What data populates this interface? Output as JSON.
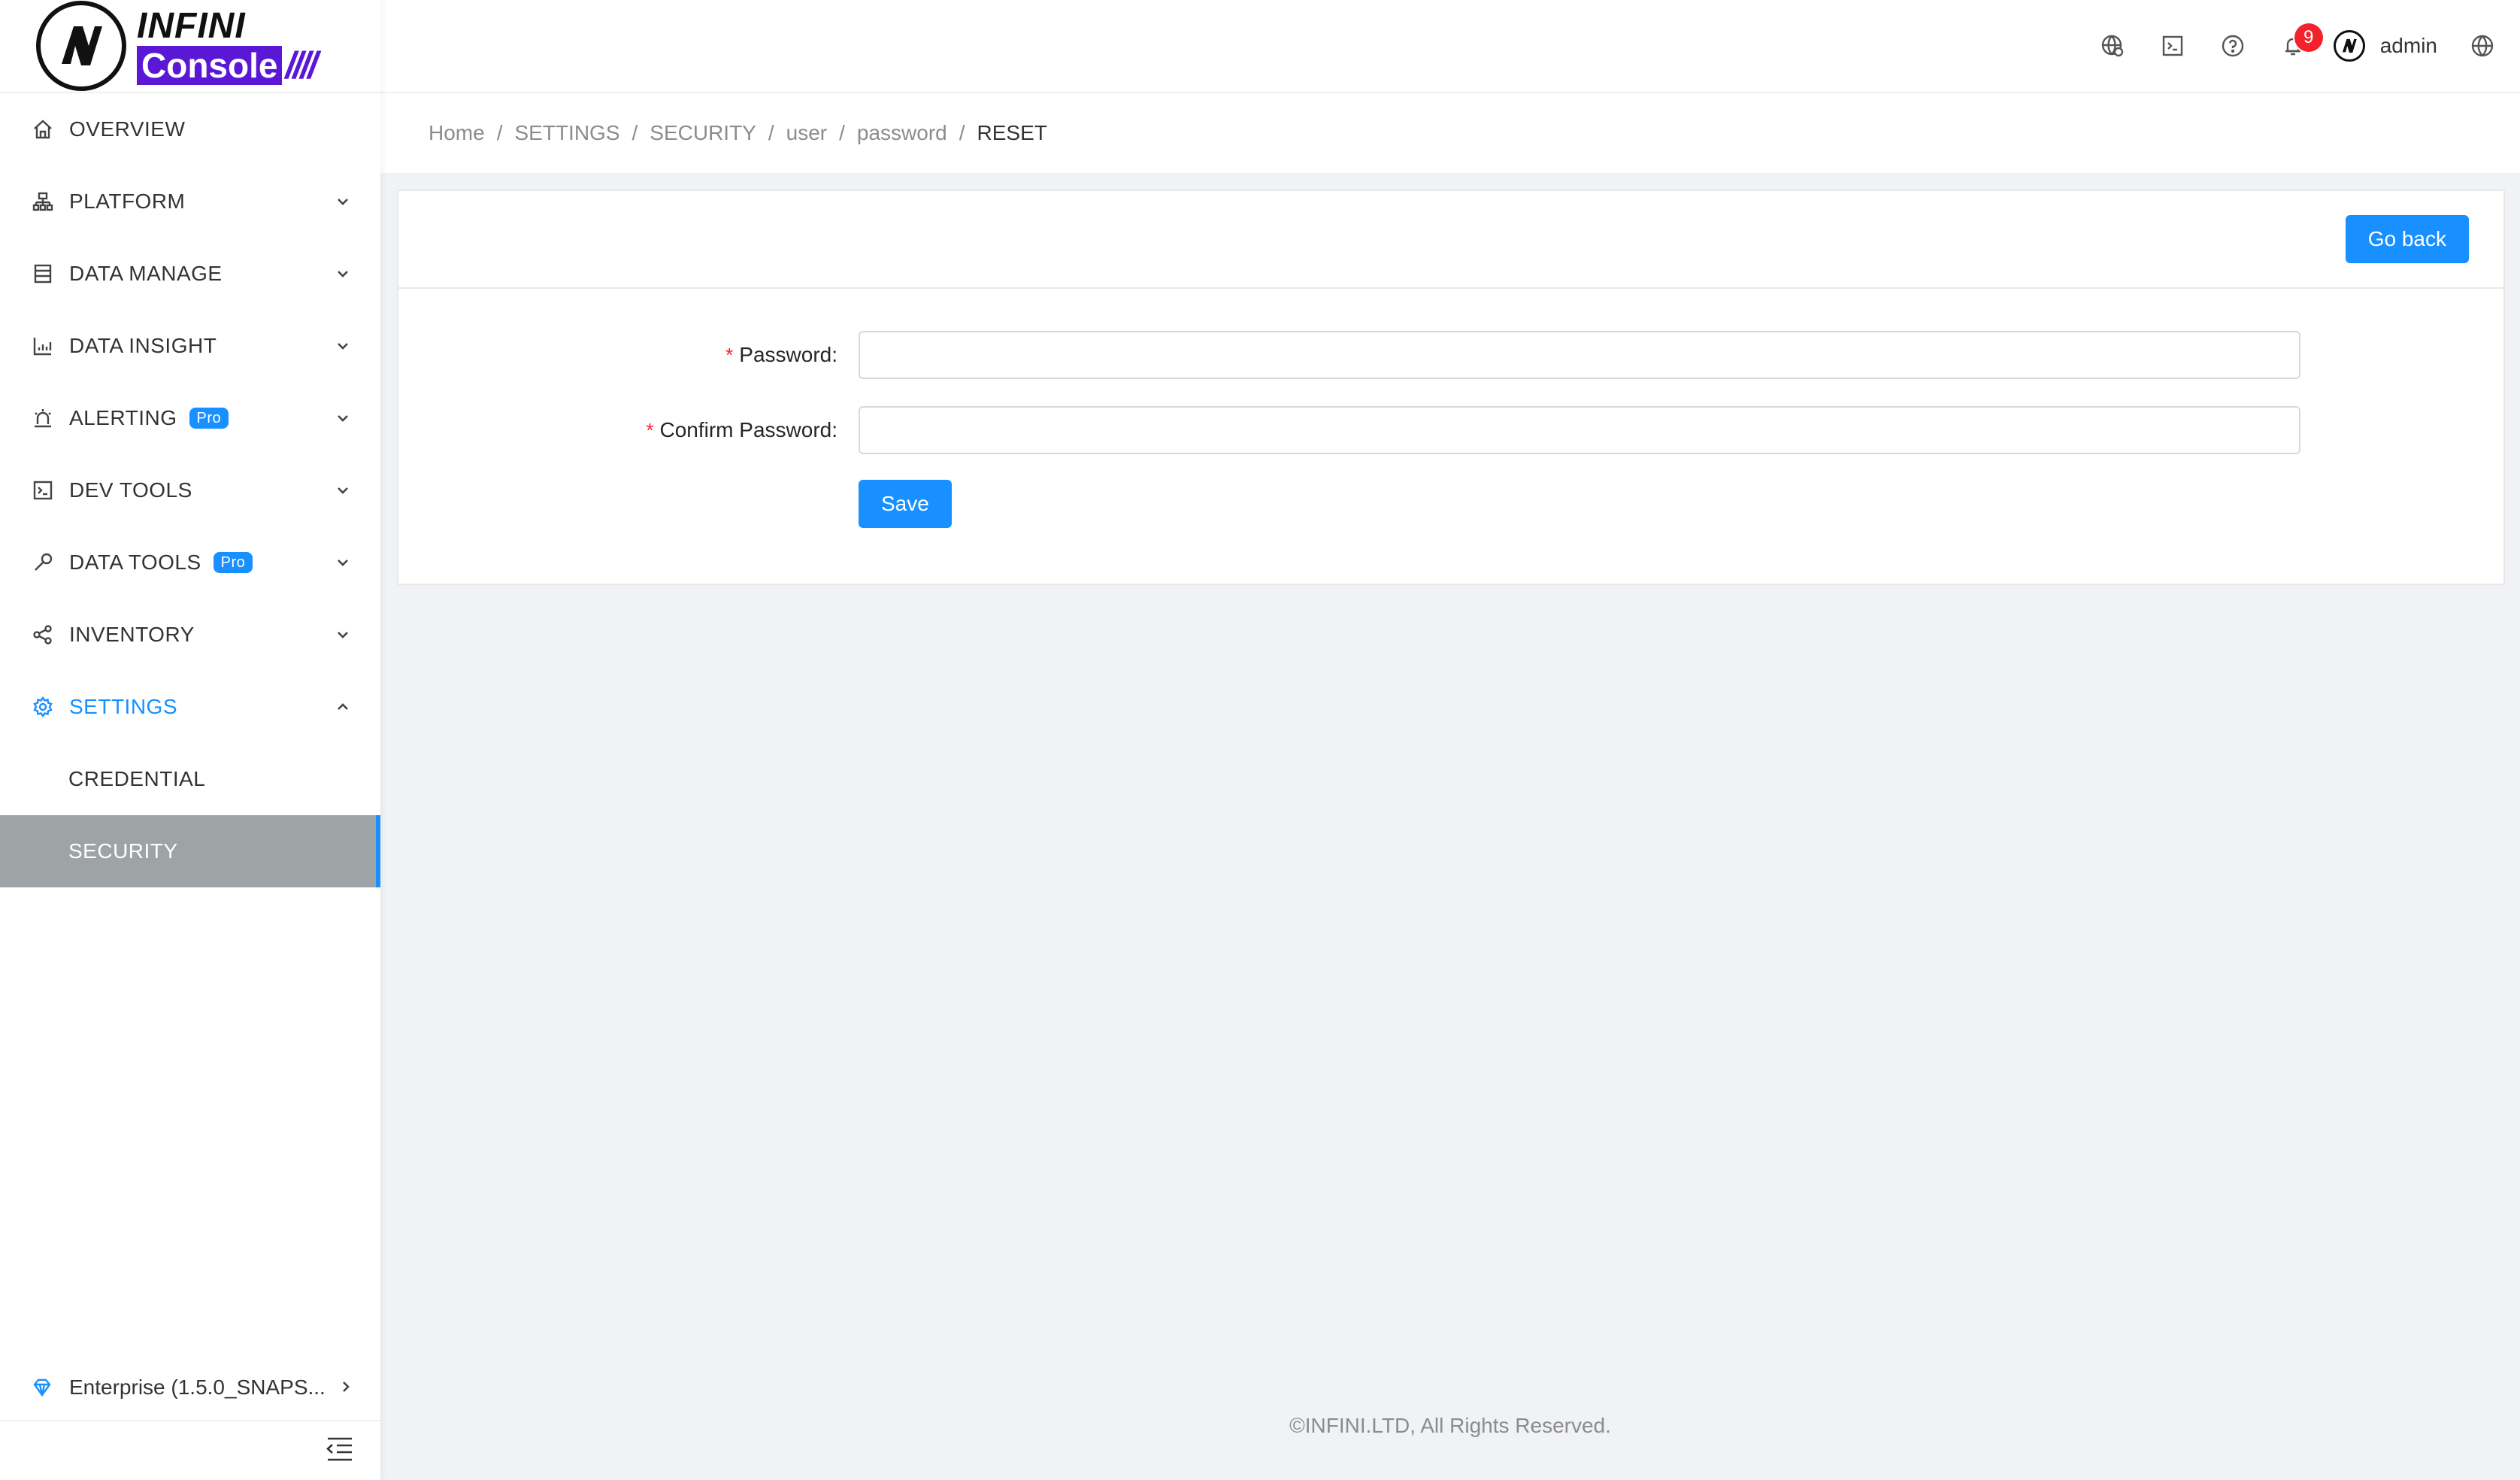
{
  "logo": {
    "top_text": "INFINI",
    "bottom_text": "Console"
  },
  "sidebar": {
    "items": [
      {
        "label": "OVERVIEW",
        "icon": "home-icon"
      },
      {
        "label": "PLATFORM",
        "icon": "cluster-icon"
      },
      {
        "label": "DATA MANAGE",
        "icon": "database-icon"
      },
      {
        "label": "DATA INSIGHT",
        "icon": "chart-icon"
      },
      {
        "label": "ALERTING",
        "icon": "alarm-icon",
        "badge": "Pro"
      },
      {
        "label": "DEV TOOLS",
        "icon": "terminal-icon"
      },
      {
        "label": "DATA TOOLS",
        "icon": "tool-icon",
        "badge": "Pro"
      },
      {
        "label": "INVENTORY",
        "icon": "share-icon"
      },
      {
        "label": "SETTINGS",
        "icon": "gear-icon"
      }
    ],
    "settings_sub": [
      {
        "label": "CREDENTIAL"
      },
      {
        "label": "SECURITY"
      }
    ],
    "edition": "Enterprise (1.5.0_SNAPS..."
  },
  "header": {
    "notification_count": "9",
    "user": "admin"
  },
  "breadcrumb": [
    "Home",
    "SETTINGS",
    "SECURITY",
    "user",
    "password",
    "RESET"
  ],
  "card": {
    "go_back_label": "Go back",
    "password_label": "Password",
    "confirm_label": "Confirm Password",
    "colon": ":",
    "required_mark": "*",
    "password_value": "",
    "confirm_value": "",
    "save_label": "Save"
  },
  "footer": "©INFINI.LTD, All Rights Reserved.",
  "colors": {
    "primary": "#1890ff",
    "brand": "#5a18d6",
    "danger": "#f5222d",
    "selected_bg": "#9ea3a6"
  }
}
